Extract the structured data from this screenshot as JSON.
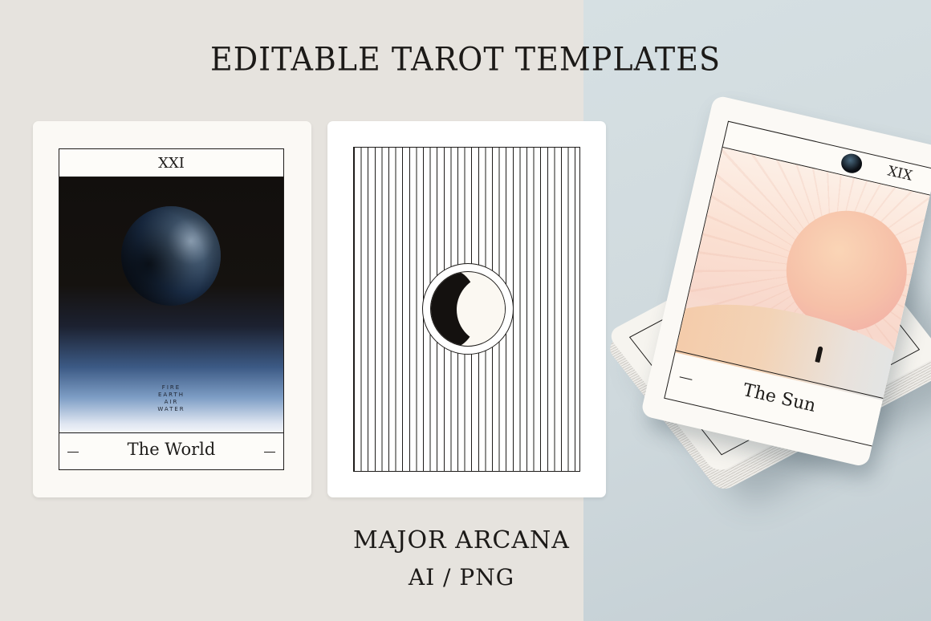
{
  "headline": "EDITABLE TAROT TEMPLATES",
  "subtitle_line1": "MAJOR ARCANA",
  "subtitle_line2": "AI / PNG",
  "cards": {
    "world": {
      "numeral": "XXI",
      "name": "The World",
      "elements": [
        "FIRE",
        "EARTH",
        "AIR",
        "WATER"
      ]
    },
    "sun": {
      "numeral": "XIX",
      "name": "The Sun"
    }
  },
  "colors": {
    "ink": "#1e1c1a",
    "background_left": "#e6e3de",
    "background_right": "#d6e0e3",
    "card": "#fbf9f5"
  }
}
